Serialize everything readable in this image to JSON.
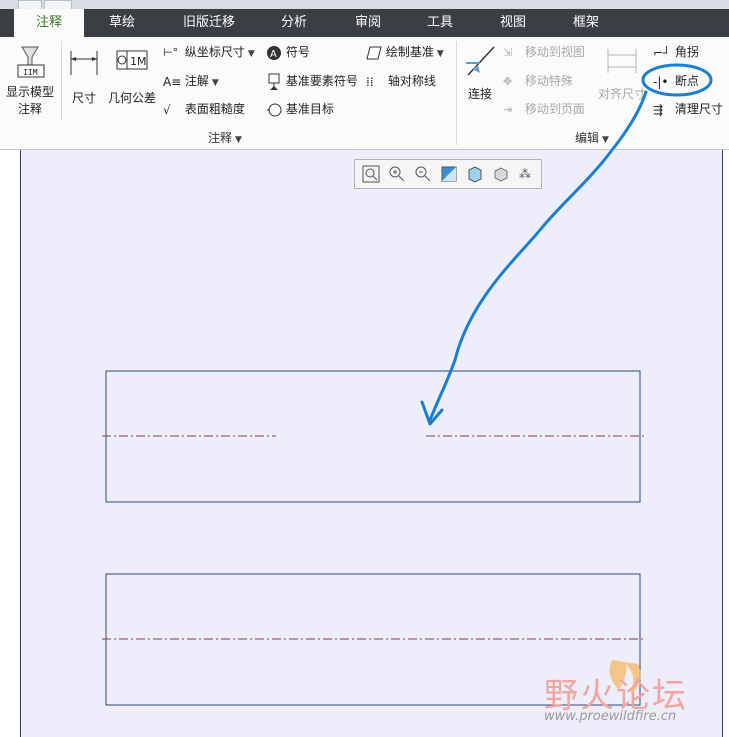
{
  "tabs": [
    {
      "label": "注释",
      "active": true
    },
    {
      "label": "草绘"
    },
    {
      "label": "旧版迁移"
    },
    {
      "label": "分析"
    },
    {
      "label": "审阅"
    },
    {
      "label": "工具"
    },
    {
      "label": "视图"
    },
    {
      "label": "框架"
    }
  ],
  "ribbon": {
    "show_model": {
      "line1": "显示模型",
      "line2": "注释"
    },
    "dimension": "尺寸",
    "gtol": "几何公差",
    "ordinate_dim": "纵坐标尺寸",
    "note": "注解",
    "surface_finish": "表面粗糙度",
    "symbol": "符号",
    "datum_feature_symbol": "基准要素符号",
    "datum_target": "基准目标",
    "draw_datum": "绘制基准",
    "axis_symmetry": "轴对称线",
    "group_annotation": "注释",
    "connect": "连接",
    "move_to_view": "移动到视图",
    "move_special": "移动特殊",
    "move_to_page": "移动到页面",
    "align_dim": "对齐尺寸",
    "jog": "角拐",
    "break": "断点",
    "cleanup_dim": "清理尺寸",
    "group_edit": "编辑"
  },
  "view_toolbar": [
    "zoom-fit-icon",
    "zoom-in-icon",
    "zoom-out-icon",
    "repaint-icon",
    "display-style-icon",
    "saved-views-icon",
    "annotation-display-icon"
  ],
  "watermark": {
    "brand": "野火论坛",
    "url": "www.proewildfire.cn"
  },
  "colors": {
    "annotation_blue": "#1a7fd4",
    "tab_active_text": "#3a7a2a",
    "sheet_bg": "#eeeefa",
    "centerline": "#8a3a50"
  }
}
